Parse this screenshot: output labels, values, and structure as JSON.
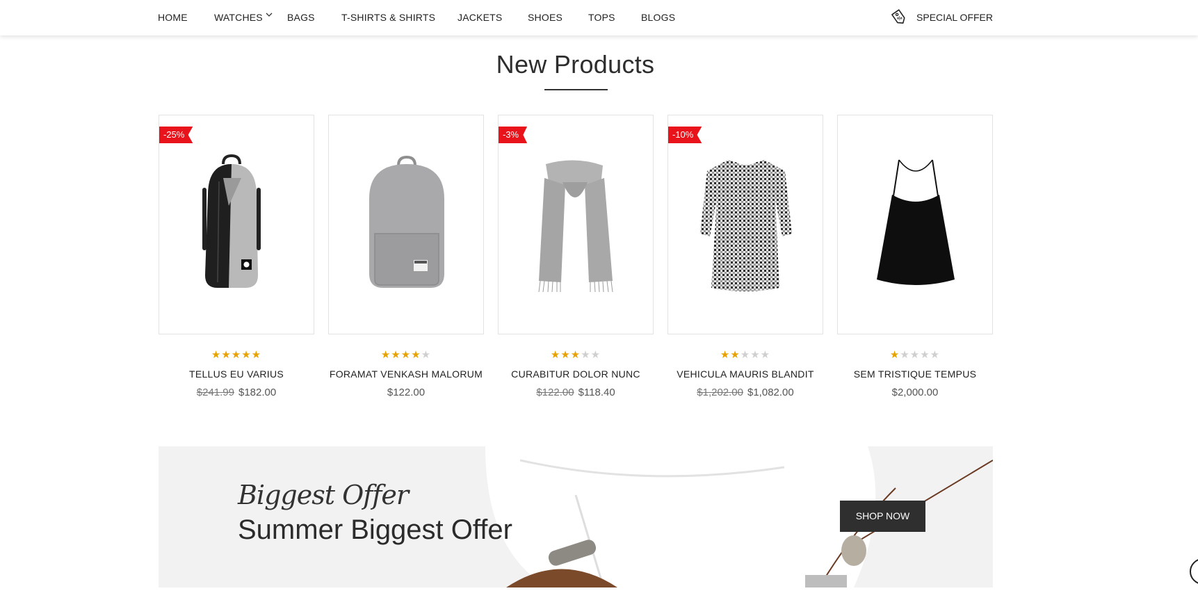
{
  "nav": {
    "items": [
      "HOME",
      "WATCHES",
      "BAGS",
      "T-SHIRTS & SHIRTS",
      "JACKETS",
      "SHOES",
      "TOPS",
      "BLOGS"
    ],
    "special_offer": "SPECIAL OFFER",
    "special_icon": "price-tag-icon"
  },
  "section": {
    "title": "New Products"
  },
  "products": [
    {
      "name": "TELLUS EU VARIUS",
      "badge": "-25%",
      "old_price": "$241.99",
      "price": "$182.00",
      "rating": 5,
      "image": "backpack-grey-black"
    },
    {
      "name": "FORAMAT VENKASH MALORUM",
      "badge": "",
      "old_price": "",
      "price": "$122.00",
      "rating": 4,
      "image": "backpack-grey"
    },
    {
      "name": "CURABITUR DOLOR NUNC",
      "badge": "-3%",
      "old_price": "$122.00",
      "price": "$118.40",
      "rating": 3,
      "image": "scarf-grey"
    },
    {
      "name": "VEHICULA MAURIS BLANDIT",
      "badge": "-10%",
      "old_price": "$1,202.00",
      "price": "$1,082.00",
      "rating": 2,
      "image": "gingham-dress"
    },
    {
      "name": "SEM TRISTIQUE TEMPUS",
      "badge": "",
      "old_price": "",
      "price": "$2,000.00",
      "rating": 1,
      "image": "black-camisole"
    }
  ],
  "banner": {
    "script_text": "Biggest Offer",
    "title": "Summer Biggest Offer",
    "button": "SHOP NOW"
  },
  "colors": {
    "badge": "#e8131b",
    "star": "#e8a200",
    "button": "#2f2f2f"
  }
}
